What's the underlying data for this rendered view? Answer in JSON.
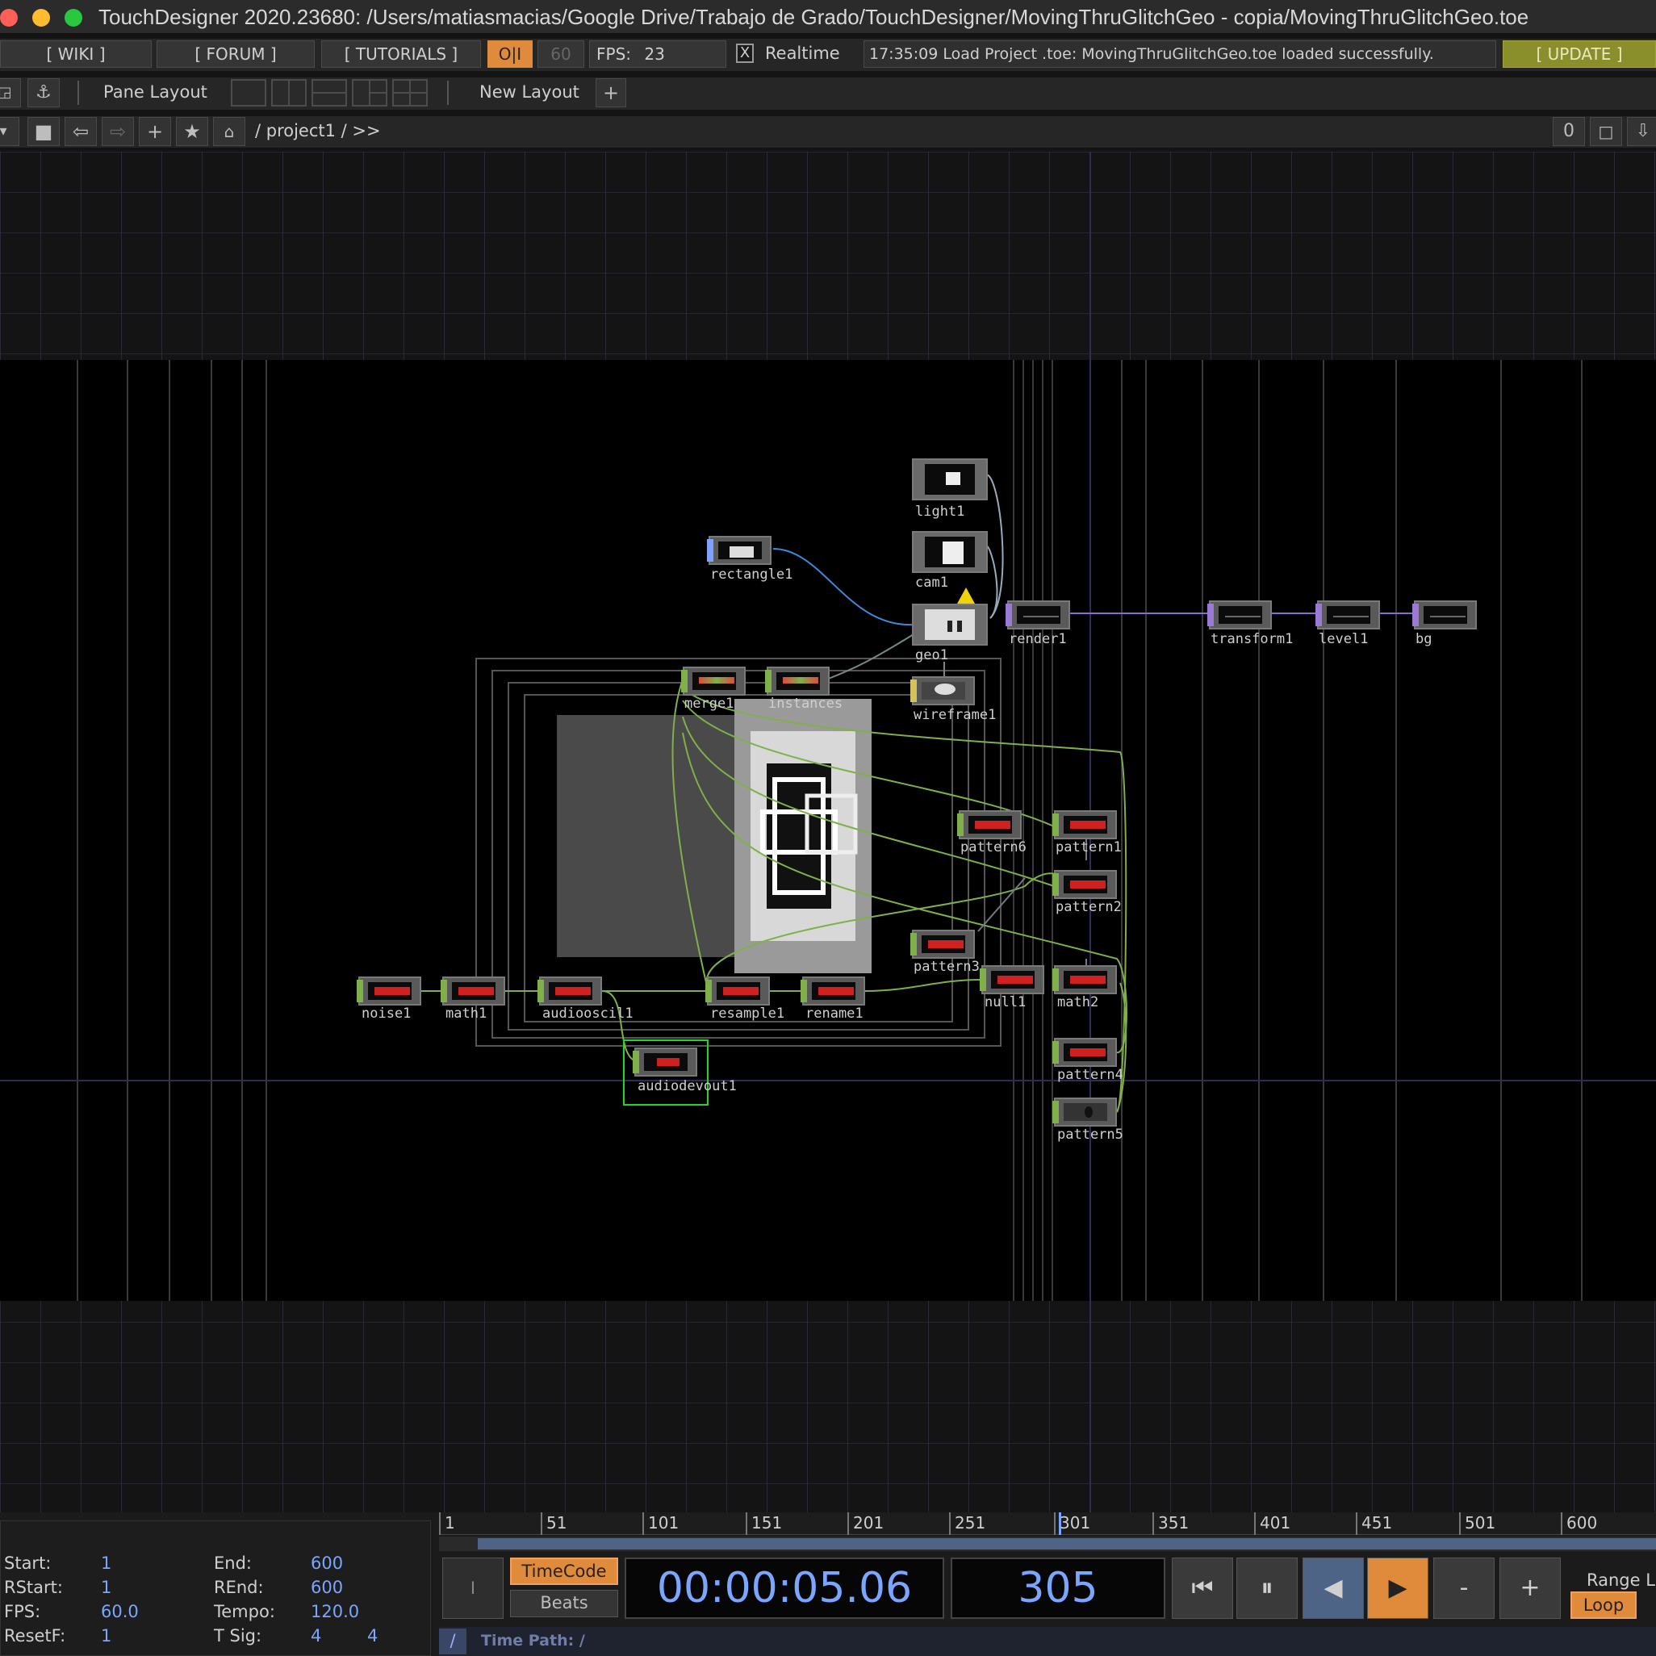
{
  "window": {
    "title": "TouchDesigner 2020.23680: /Users/matiasmacias/Google Drive/Trabajo de Grado/TouchDesigner/MovingThruGlitchGeo - copia/MovingThruGlitchGeo.toe"
  },
  "toolbar": {
    "wiki": "[ WIKI ]",
    "forum": "[ FORUM ]",
    "tutorials": "[ TUTORIALS ]",
    "oi": "O|I",
    "fps_limit": "60",
    "fps_label": "FPS:",
    "fps_value": "23",
    "realtime_check": "X",
    "realtime": "Realtime",
    "message": "17:35:09 Load Project .toe: MovingThruGlitchGeo.toe loaded successfully.",
    "update": "[ UPDATE ]"
  },
  "layout_bar": {
    "pane_layout": "Pane Layout",
    "new_layout": "New Layout",
    "add": "+"
  },
  "path_bar": {
    "path": "/ project1 / >>",
    "counter": "0"
  },
  "nodes": [
    {
      "label": "light1",
      "family": "COMP"
    },
    {
      "label": "cam1",
      "family": "COMP"
    },
    {
      "label": "rectangle1",
      "family": "TOP"
    },
    {
      "label": "geo1",
      "family": "COMP"
    },
    {
      "label": "render1",
      "family": "TOP"
    },
    {
      "label": "transform1",
      "family": "TOP"
    },
    {
      "label": "level1",
      "family": "TOP"
    },
    {
      "label": "bg",
      "family": "TOP"
    },
    {
      "label": "merge1",
      "family": "SOP"
    },
    {
      "label": "instances",
      "family": "SOP"
    },
    {
      "label": "wireframe1",
      "family": "MAT"
    },
    {
      "label": "pattern6",
      "family": "CHOP"
    },
    {
      "label": "pattern1",
      "family": "CHOP"
    },
    {
      "label": "pattern2",
      "family": "CHOP"
    },
    {
      "label": "pattern3",
      "family": "CHOP"
    },
    {
      "label": "noise1",
      "family": "CHOP"
    },
    {
      "label": "math1",
      "family": "CHOP"
    },
    {
      "label": "audiooscil1",
      "family": "CHOP"
    },
    {
      "label": "resample1",
      "family": "CHOP"
    },
    {
      "label": "rename1",
      "family": "CHOP"
    },
    {
      "label": "null1",
      "family": "CHOP"
    },
    {
      "label": "math2",
      "family": "CHOP"
    },
    {
      "label": "audiodevout1",
      "family": "CHOP"
    },
    {
      "label": "pattern4",
      "family": "CHOP"
    },
    {
      "label": "pattern5",
      "family": "CHOP"
    }
  ],
  "colors": {
    "top": "#7ea3ff",
    "comp": "#8a8a8a",
    "chop": "#7fb04a",
    "sop": "#7fb04a",
    "mat": "#d4c35a",
    "render": "#9a7ad4",
    "wire_chop": "#7fb04a",
    "wire_top": "#3d8bd8",
    "accent_orange": "#e08a3c",
    "update_green": "#8a8f2c"
  },
  "timeline": {
    "ticks": [
      "1",
      "51",
      "101",
      "151",
      "201",
      "251",
      "301",
      "351",
      "401",
      "451",
      "501",
      "600"
    ],
    "start_label": "Start:",
    "start": "1",
    "end_label": "End:",
    "end": "600",
    "rstart_label": "RStart:",
    "rstart": "1",
    "rend_label": "REnd:",
    "rend": "600",
    "fps_label": "FPS:",
    "fps": "60.0",
    "tempo_label": "Tempo:",
    "tempo": "120.0",
    "resetf_label": "ResetF:",
    "resetf": "1",
    "tsig_label": "T Sig:",
    "tsig_a": "4",
    "tsig_b": "4",
    "timecode_btn": "TimeCode",
    "beats_btn": "Beats",
    "timecode": "00:00:05.06",
    "frame": "305",
    "range_label": "Range L",
    "loop": "Loop",
    "time_path_slash": "/",
    "time_path": "Time Path: /",
    "minus": "-",
    "plus": "+"
  }
}
